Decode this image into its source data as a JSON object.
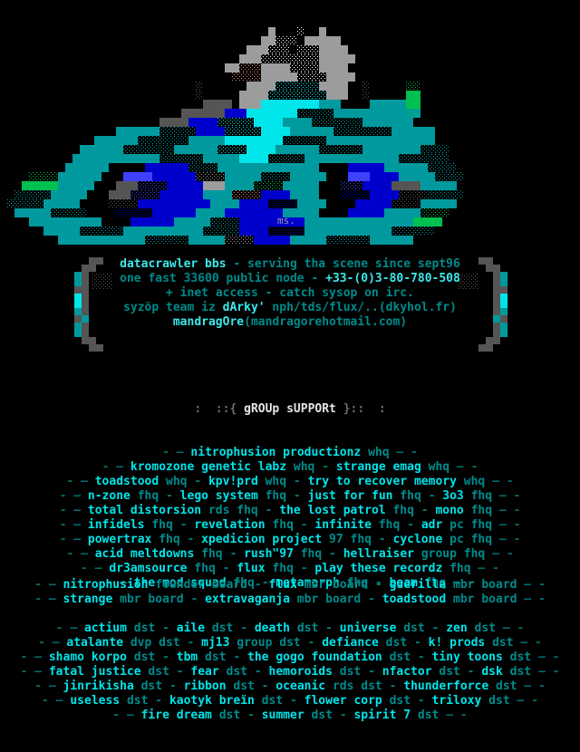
{
  "scene": {
    "artist_signature": "ms.",
    "palette": {
      "background": "#000000",
      "bright_cyan": "#00e5ea",
      "cyan": "#00cfd4",
      "dim_teal": "#008b8b",
      "teal": "#009a9e",
      "blue": "#0000cd",
      "light_blue": "#4040ff",
      "white": "#ffffff",
      "gray": "#9c9c9c",
      "dark_gray": "#555555",
      "green": "#00c050",
      "salmon": "#e08878"
    }
  },
  "bbs": {
    "lines": [
      [
        {
          "t": "datacrawler bbs",
          "s": "brt"
        },
        {
          "t": " - ",
          "s": "dim"
        },
        {
          "t": "serving tha scene since sept96",
          "s": "dim"
        }
      ],
      [
        {
          "t": "one fast 33600 public node",
          "s": "dim"
        },
        {
          "t": " - ",
          "s": "dim"
        },
        {
          "t": "+33-(0)3-80-780-508",
          "s": "brt"
        }
      ],
      [
        {
          "t": "+ inet access - catch sysop on irc.",
          "s": "dim"
        }
      ],
      [
        {
          "t": "syzöp team iz ",
          "s": "dim"
        },
        {
          "t": "dArky'",
          "s": "brt"
        },
        {
          "t": " nph/tds/flux/..(dkyhol.fr)",
          "s": "dim"
        }
      ],
      [
        {
          "t": "mandragOre",
          "s": "brt"
        },
        {
          "t": "(mandragorehotmail.com)",
          "s": "dim"
        }
      ]
    ]
  },
  "support": {
    "header": "  :  ::{ gROUp sUPPORt }::  : ",
    "header_parts": [
      {
        "t": ":  ::{ ",
        "s": "hd-dim"
      },
      {
        "t": "gROUp sUPPORt",
        "s": "hd-brt"
      },
      {
        "t": " }::  :",
        "s": "hd-dim"
      }
    ],
    "lines": [
      {
        "left": "- — ",
        "right": " — -",
        "entries": [
          {
            "name": "nitrophusion productionz",
            "tag": "whq"
          }
        ]
      },
      {
        "left": "- — ",
        "right": " — -",
        "entries": [
          {
            "name": "kromozone genetic labz",
            "tag": "whq"
          },
          {
            "name": "strange emag",
            "tag": "whq"
          }
        ]
      },
      {
        "left": "- — ",
        "right": " — -",
        "entries": [
          {
            "name": "toadstood",
            "tag": "whq"
          },
          {
            "name": "kpv!prd",
            "tag": "whq"
          },
          {
            "name": "try to recover memory",
            "tag": "whq"
          }
        ]
      },
      {
        "left": "- — ",
        "right": " — -",
        "entries": [
          {
            "name": "n-zone",
            "tag": "fhq"
          },
          {
            "name": "lego system",
            "tag": "fhq"
          },
          {
            "name": "just for fun",
            "tag": "fhq"
          },
          {
            "name": "3o3",
            "tag": "fhq"
          }
        ]
      },
      {
        "left": "- — ",
        "right": " — -",
        "entries": [
          {
            "name": "total distorsion",
            "tag": "rds fhq"
          },
          {
            "name": "the lost patrol",
            "tag": "fhq"
          },
          {
            "name": "mono",
            "tag": "fhq"
          }
        ]
      },
      {
        "left": "- — ",
        "right": " — -",
        "entries": [
          {
            "name": "infidels",
            "tag": "fhq"
          },
          {
            "name": "revelation",
            "tag": "fhq"
          },
          {
            "name": "infinite",
            "tag": "fhq"
          },
          {
            "name": "adr",
            "tag": "pc fhq"
          }
        ]
      },
      {
        "left": "- — ",
        "right": " — -",
        "entries": [
          {
            "name": "powertrax",
            "tag": "fhq"
          },
          {
            "name": "xpedicion project",
            "tag": "97 fhq"
          },
          {
            "name": "cyclone",
            "tag": "pc fhq"
          }
        ]
      },
      {
        "left": "- — ",
        "right": " — -",
        "entries": [
          {
            "name": "acid meltdowns",
            "tag": "fhq"
          },
          {
            "name": "rush\"97",
            "tag": "fhq"
          },
          {
            "name": "hellraiser",
            "tag": "group fhq"
          }
        ]
      },
      {
        "left": "- — ",
        "right": " — -",
        "entries": [
          {
            "name": "dr3amsource",
            "tag": "fhq"
          },
          {
            "name": "flux",
            "tag": "fhq"
          },
          {
            "name": "play these recordz",
            "tag": "fhq"
          }
        ]
      },
      {
        "left": "- — ",
        "right": " — -",
        "entries": [
          {
            "name": "the mod squad",
            "tag": "fhq"
          },
          {
            "name": "metamorph",
            "tag": "fhq"
          },
          {
            "name": "beam",
            "tag": "fhq"
          }
        ]
      }
    ]
  },
  "boards": {
    "lines": [
      {
        "left": "- — ",
        "right": " — -",
        "entries": [
          {
            "name": "nitrophusion",
            "tag": "founder board"
          },
          {
            "name": "flux",
            "tag": "mbr board"
          },
          {
            "name": "guerilla",
            "tag": "mbr board"
          }
        ]
      },
      {
        "left": "- — ",
        "right": " — -",
        "entries": [
          {
            "name": "strange",
            "tag": "mbr board"
          },
          {
            "name": "extravaganja",
            "tag": "mbr board"
          },
          {
            "name": "toadstood",
            "tag": "mbr board"
          }
        ]
      }
    ]
  },
  "distros": {
    "lines": [
      {
        "left": "- — ",
        "right": " — -",
        "entries": [
          {
            "name": "actium",
            "tag": "dst"
          },
          {
            "name": "aile",
            "tag": "dst"
          },
          {
            "name": "death",
            "tag": "dst"
          },
          {
            "name": "universe",
            "tag": "dst"
          },
          {
            "name": "zen",
            "tag": "dst"
          }
        ]
      },
      {
        "left": "- — ",
        "right": " — -",
        "entries": [
          {
            "name": "atalante",
            "tag": "dvp dst"
          },
          {
            "name": "mj13",
            "tag": "group dst"
          },
          {
            "name": "defiance",
            "tag": "dst"
          },
          {
            "name": "k! prods",
            "tag": "dst"
          }
        ]
      },
      {
        "left": "- — ",
        "right": " — -",
        "entries": [
          {
            "name": "shamo korpo",
            "tag": "dst"
          },
          {
            "name": "tbm",
            "tag": "dst"
          },
          {
            "name": "the gogo foundation",
            "tag": "dst"
          },
          {
            "name": "tiny toons",
            "tag": "dst"
          }
        ]
      },
      {
        "left": "- — ",
        "right": " — -",
        "entries": [
          {
            "name": "fatal justice",
            "tag": "dst"
          },
          {
            "name": "fear",
            "tag": "dst"
          },
          {
            "name": "hemoroids",
            "tag": "dst"
          },
          {
            "name": "nfactor",
            "tag": "dst"
          },
          {
            "name": "dsk",
            "tag": "dst"
          }
        ]
      },
      {
        "left": "- — ",
        "right": " — -",
        "entries": [
          {
            "name": "jinrikisha",
            "tag": "dst"
          },
          {
            "name": "ribbon",
            "tag": "dst"
          },
          {
            "name": "oceanic",
            "tag": "rds dst"
          },
          {
            "name": "thunderforce",
            "tag": "dst"
          }
        ]
      },
      {
        "left": "- — ",
        "right": " — -",
        "entries": [
          {
            "name": "useless",
            "tag": "dst"
          },
          {
            "name": "kaotyk breïn",
            "tag": "dst"
          },
          {
            "name": "flower corp",
            "tag": "dst"
          },
          {
            "name": "triloxy",
            "tag": "dst"
          }
        ]
      },
      {
        "left": "- — ",
        "right": " — -",
        "entries": [
          {
            "name": "fire dream",
            "tag": "dst"
          },
          {
            "name": "summer",
            "tag": "dst"
          },
          {
            "name": "spirit 7",
            "tag": "dst"
          }
        ]
      }
    ]
  }
}
